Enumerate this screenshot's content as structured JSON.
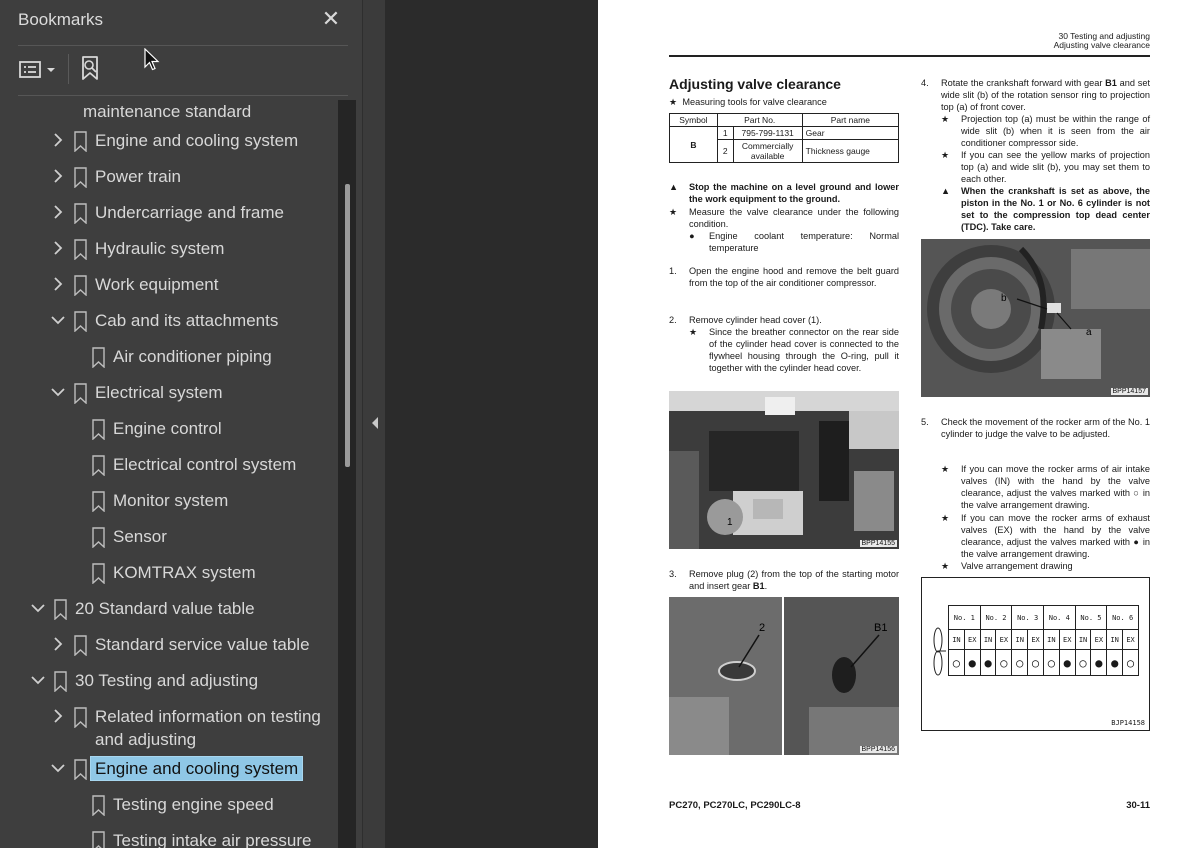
{
  "panel": {
    "title": "Bookmarks",
    "close_glyph": "✕",
    "toolbar": {
      "view_icon": "list-view-icon",
      "find_icon": "bookmark-search-icon"
    },
    "items": [
      {
        "label": "maintenance standard",
        "level": 2,
        "twisty": "none",
        "icon": false
      },
      {
        "label": "Engine and cooling system",
        "level": 2,
        "twisty": "collapsed"
      },
      {
        "label": "Power train",
        "level": 2,
        "twisty": "collapsed"
      },
      {
        "label": "Undercarriage and frame",
        "level": 2,
        "twisty": "collapsed"
      },
      {
        "label": "Hydraulic system",
        "level": 2,
        "twisty": "collapsed"
      },
      {
        "label": "Work equipment",
        "level": 2,
        "twisty": "collapsed"
      },
      {
        "label": "Cab and its attachments",
        "level": 2,
        "twisty": "expanded"
      },
      {
        "label": "Air conditioner piping",
        "level": 3,
        "twisty": "none"
      },
      {
        "label": "Electrical system",
        "level": 2,
        "twisty": "expanded"
      },
      {
        "label": "Engine control",
        "level": 3,
        "twisty": "none"
      },
      {
        "label": "Electrical control system",
        "level": 3,
        "twisty": "none"
      },
      {
        "label": "Monitor system",
        "level": 3,
        "twisty": "none"
      },
      {
        "label": "Sensor",
        "level": 3,
        "twisty": "none"
      },
      {
        "label": "KOMTRAX system",
        "level": 3,
        "twisty": "none"
      },
      {
        "label": "20 Standard value table",
        "level": 1,
        "twisty": "expanded"
      },
      {
        "label": "Standard service value table",
        "level": 2,
        "twisty": "collapsed"
      },
      {
        "label": "30 Testing and adjusting",
        "level": 1,
        "twisty": "expanded"
      },
      {
        "label": "Related information on testing",
        "label2": "and adjusting",
        "level": 2,
        "twisty": "collapsed"
      },
      {
        "label": "Engine and cooling system",
        "level": 2,
        "twisty": "expanded",
        "selected": true
      },
      {
        "label": "Testing engine speed",
        "level": 3,
        "twisty": "none"
      },
      {
        "label": "Testing intake air pressure",
        "level": 3,
        "twisty": "none"
      }
    ]
  },
  "doc": {
    "header": {
      "line1": "30 Testing and adjusting",
      "line2": "Adjusting valve clearance"
    },
    "title": "Adjusting valve clearance",
    "tools_note": "Measuring tools for valve clearance",
    "tools_table": {
      "headers": [
        "Symbol",
        "Part No.",
        "Part name"
      ],
      "symbol": "B",
      "rows": [
        {
          "no": "1",
          "part_no": "795-799-1131",
          "name": "Gear"
        },
        {
          "no": "2",
          "part_no": "Commercially available",
          "name": "Thickness gauge"
        }
      ]
    },
    "warning1": "Stop the machine on a level ground and lower the work equipment to the ground.",
    "star1": "Measure the valve clearance under the following condition.",
    "bullet1": "Engine coolant temperature: Normal temperature",
    "step1": "Open the engine hood and remove the belt guard from the top of the air conditioner compressor.",
    "step2": "Remove cylinder head cover (1).",
    "step2_star": "Since the breather connector on the rear side of the cylinder head cover is connected to the flywheel housing through the O-ring, pull it together with the cylinder head cover.",
    "photo1_code": "BPP14155",
    "photo1_callout": "1",
    "step3_a": "Remove plug (2) from the top of the starting motor and insert gear ",
    "step3_b": "B1",
    "step3_c": ".",
    "photo2_code": "BPP14156",
    "photo2_callout_a": "2",
    "photo2_callout_b": "B1",
    "step4_a": "Rotate the crankshaft forward with gear ",
    "step4_b": "B1",
    "step4_c": " and set wide slit (b) of the rotation sensor ring to projection top (a) of front cover.",
    "step4_star1": "Projection top (a) must be within the range of wide slit (b) when it is seen from the air conditioner compressor side.",
    "step4_star2": "If you can see the yellow marks of projection top (a) and wide slit (b), you may set them to each other.",
    "warning2": "When the crankshaft is set as above, the piston in the No. 1 or No. 6 cylinder is not set to the compression top dead center (TDC). Take care.",
    "photo3_code": "BPP14157",
    "photo3_callout_a": "b",
    "photo3_callout_b": "a",
    "step5": "Check the movement of the rocker arm of the No. 1 cylinder to judge the valve to be adjusted.",
    "step5_star1": "If you can move the rocker arms of air intake valves (IN) with the hand by the valve clearance, adjust the valves marked with ○ in the valve arrangement drawing.",
    "step5_star2": "If you can move the rocker arms of exhaust valves (EX) with the hand by the valve clearance, adjust the valves marked with ● in the valve arrangement drawing.",
    "step5_star3": "Valve arrangement drawing",
    "valve_table": {
      "cylinders": [
        "No. 1",
        "No. 2",
        "No. 3",
        "No. 4",
        "No. 5",
        "No. 6"
      ],
      "valves": [
        "IN",
        "EX",
        "IN",
        "EX",
        "IN",
        "EX",
        "IN",
        "EX",
        "IN",
        "EX",
        "IN",
        "EX"
      ],
      "marks": [
        "○",
        "●",
        "●",
        "○",
        "○",
        "○",
        "○",
        "●",
        "○",
        "●",
        "●",
        "○"
      ],
      "code": "BJP14158"
    },
    "footer_left": "PC270, PC270LC, PC290LC-8",
    "footer_right": "30-11"
  }
}
